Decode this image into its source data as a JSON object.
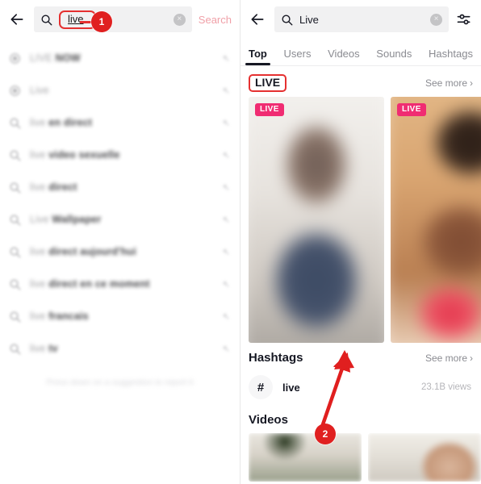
{
  "left_panel": {
    "back_icon": "back-arrow-icon",
    "search": {
      "glass_icon": "search-icon",
      "value": "live",
      "clear_icon": "clear-circle-icon",
      "clear_glyph": "×"
    },
    "search_button_label": "Search",
    "suggestions": [
      {
        "icon": "live-circle-icon",
        "prefix": "LIVE",
        "bold": "NOW",
        "arrow": "↖"
      },
      {
        "icon": "live-circle-icon",
        "prefix": "Live",
        "bold": "",
        "arrow": "↖"
      },
      {
        "icon": "search-icon",
        "prefix": "live",
        "bold": "en direct",
        "arrow": "↖"
      },
      {
        "icon": "search-icon",
        "prefix": "live",
        "bold": "video sexuelle",
        "arrow": "↖"
      },
      {
        "icon": "search-icon",
        "prefix": "live",
        "bold": "direct",
        "arrow": "↖"
      },
      {
        "icon": "search-icon",
        "prefix": "Live",
        "bold": "Wallpaper",
        "arrow": "↖"
      },
      {
        "icon": "search-icon",
        "prefix": "live",
        "bold": "direct aujourd'hui",
        "arrow": "↖"
      },
      {
        "icon": "search-icon",
        "prefix": "live",
        "bold": "direct en ce moment",
        "arrow": "↖"
      },
      {
        "icon": "search-icon",
        "prefix": "live",
        "bold": "francais",
        "arrow": "↖"
      },
      {
        "icon": "search-icon",
        "prefix": "live",
        "bold": "tv",
        "arrow": "↖"
      }
    ],
    "hint": "Press down on a suggestion to report it"
  },
  "right_panel": {
    "back_icon": "back-arrow-icon",
    "search": {
      "glass_icon": "search-icon",
      "value": "Live",
      "clear_icon": "clear-circle-icon",
      "clear_glyph": "×"
    },
    "filter_icon": "filter-sliders-icon",
    "tabs": [
      {
        "label": "Top",
        "active": true
      },
      {
        "label": "Users",
        "active": false
      },
      {
        "label": "Videos",
        "active": false
      },
      {
        "label": "Sounds",
        "active": false
      },
      {
        "label": "Hashtags",
        "active": false
      }
    ],
    "live_section": {
      "title": "LIVE",
      "see_more": "See more",
      "chevron": "›",
      "cards": [
        {
          "badge": "LIVE"
        },
        {
          "badge": "LIVE"
        }
      ]
    },
    "hashtags_section": {
      "title": "Hashtags",
      "see_more": "See more",
      "chevron": "›",
      "items": [
        {
          "hash_glyph": "#",
          "name": "live",
          "views": "23.1B views"
        }
      ]
    },
    "videos_section": {
      "title": "Videos"
    }
  },
  "annotations": [
    {
      "number": "1"
    },
    {
      "number": "2"
    }
  ],
  "colors": {
    "annotation_red": "#e02020",
    "live_badge_pink": "#f02c72",
    "search_action_pink": "#f0a0a8",
    "text_primary": "#161823",
    "text_muted": "#8a8b91"
  }
}
